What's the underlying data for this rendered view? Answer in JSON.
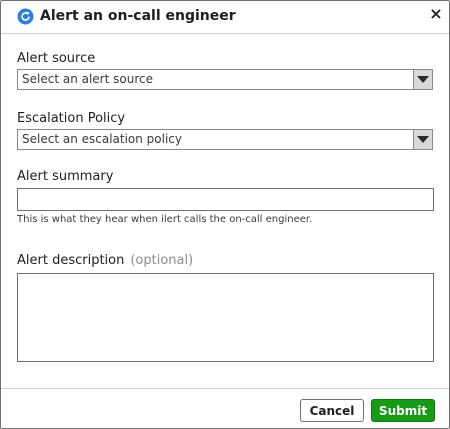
{
  "dialog": {
    "title": "Alert an on-call engineer",
    "close_symbol": "×",
    "icon": "refresh-circle-icon"
  },
  "form": {
    "alert_source": {
      "label": "Alert source",
      "placeholder": "Select an alert source"
    },
    "escalation_policy": {
      "label": "Escalation Policy",
      "placeholder": "Select an escalation policy"
    },
    "alert_summary": {
      "label": "Alert summary",
      "value": "",
      "help": "This is what they hear when ilert calls the on-call engineer."
    },
    "alert_description": {
      "label": "Alert description",
      "optional": "(optional)",
      "value": ""
    }
  },
  "footer": {
    "cancel_label": "Cancel",
    "submit_label": "Submit"
  },
  "colors": {
    "accent_icon": "#2e7fd6",
    "submit": "#179a17"
  }
}
